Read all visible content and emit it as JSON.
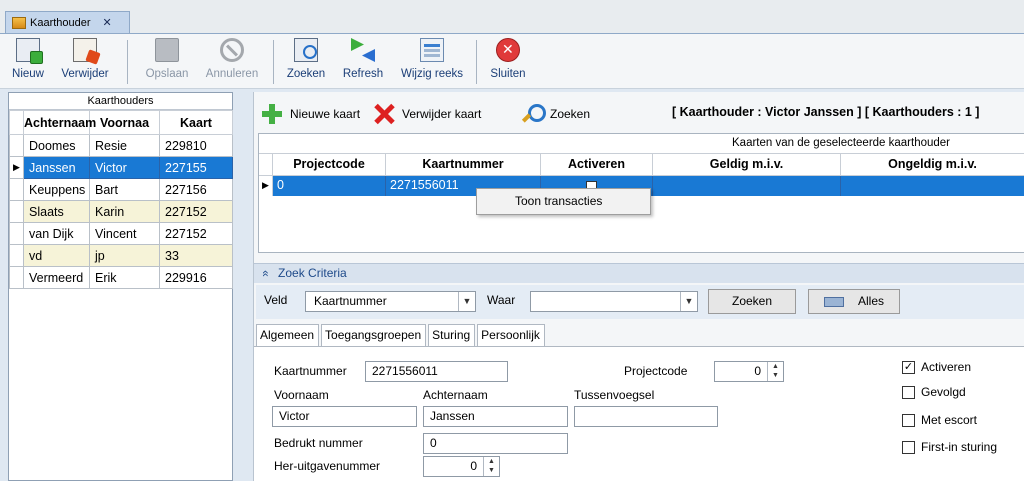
{
  "tab": {
    "label": "Kaarthouder",
    "close": "✕"
  },
  "toolbar": {
    "items": [
      {
        "label": "Nieuw",
        "icon": "new-record-icon"
      },
      {
        "label": "Verwijder",
        "icon": "delete-record-icon"
      },
      {
        "label": "Opslaan",
        "icon": "save-icon",
        "disabled": true
      },
      {
        "label": "Annuleren",
        "icon": "cancel-icon",
        "disabled": true
      },
      {
        "label": "Zoeken",
        "icon": "search-icon"
      },
      {
        "label": "Refresh",
        "icon": "refresh-icon"
      },
      {
        "label": "Wijzig reeks",
        "icon": "range-icon"
      },
      {
        "label": "Sluiten",
        "icon": "close-icon"
      }
    ]
  },
  "left": {
    "caption": "Kaarthouders",
    "columns": [
      "Achternaam",
      "Voornaa",
      "Kaart"
    ],
    "rows": [
      {
        "achternaam": "Doomes",
        "voornaam": "Resie",
        "kaart": "229810"
      },
      {
        "achternaam": "Janssen",
        "voornaam": "Victor",
        "kaart": "227155"
      },
      {
        "achternaam": "Keuppens",
        "voornaam": "Bart",
        "kaart": "227156"
      },
      {
        "achternaam": "Slaats",
        "voornaam": "Karin",
        "kaart": "227152"
      },
      {
        "achternaam": "van Dijk",
        "voornaam": "Vincent",
        "kaart": "227152"
      },
      {
        "achternaam": "vd",
        "voornaam": "jp",
        "kaart": "33"
      },
      {
        "achternaam": "Vermeerd",
        "voornaam": "Erik",
        "kaart": "229916"
      }
    ],
    "row_indicator": "▶"
  },
  "right_toolbar": {
    "new_card": "Nieuwe kaart",
    "delete_card": "Verwijder kaart",
    "search": "Zoeken",
    "info": "[ Kaarthouder : Victor Janssen ]  [ Kaarthouders : 1 ]"
  },
  "cards_grid": {
    "caption": "Kaarten van de geselecteerde kaarthouder",
    "columns": [
      "Projectcode",
      "Kaartnummer",
      "Activeren",
      "Geldig m.i.v.",
      "Ongeldig m.i.v."
    ],
    "row": {
      "projectcode": "0",
      "kaartnummer": "2271556011",
      "activeren": true,
      "geldig": "",
      "ongeldig": ""
    }
  },
  "context_menu": {
    "item": "Toon transacties"
  },
  "search_criteria": {
    "header": "Zoek Criteria",
    "collapse_glyph": "«",
    "veld_label": "Veld",
    "veld_value": "Kaartnummer",
    "waar_label": "Waar",
    "waar_value": "",
    "zoeken_button": "Zoeken",
    "alles_button": "Alles"
  },
  "detail_tabs": [
    "Algemeen",
    "Toegangsgroepen",
    "Sturing",
    "Persoonlijk"
  ],
  "detail": {
    "kaartnummer_label": "Kaartnummer",
    "kaartnummer": "2271556011",
    "projectcode_label": "Projectcode",
    "projectcode": "0",
    "voornaam_label": "Voornaam",
    "voornaam": "Victor",
    "achternaam_label": "Achternaam",
    "achternaam": "Janssen",
    "tussenvoegsel_label": "Tussenvoegsel",
    "tussenvoegsel": "",
    "bedrukt_label": "Bedrukt nummer",
    "bedrukt": "0",
    "heruitgave_label": "Her-uitgavenummer",
    "heruitgave": "0",
    "checkboxes": [
      {
        "label": "Activeren",
        "checked": true
      },
      {
        "label": "Gevolgd",
        "checked": false
      },
      {
        "label": "Met escort",
        "checked": false
      },
      {
        "label": "First-in sturing",
        "checked": false
      }
    ]
  },
  "colors": {
    "selection": "#1979d4",
    "alt_row": "#f6f3d8",
    "panel": "#dfe8f2"
  }
}
